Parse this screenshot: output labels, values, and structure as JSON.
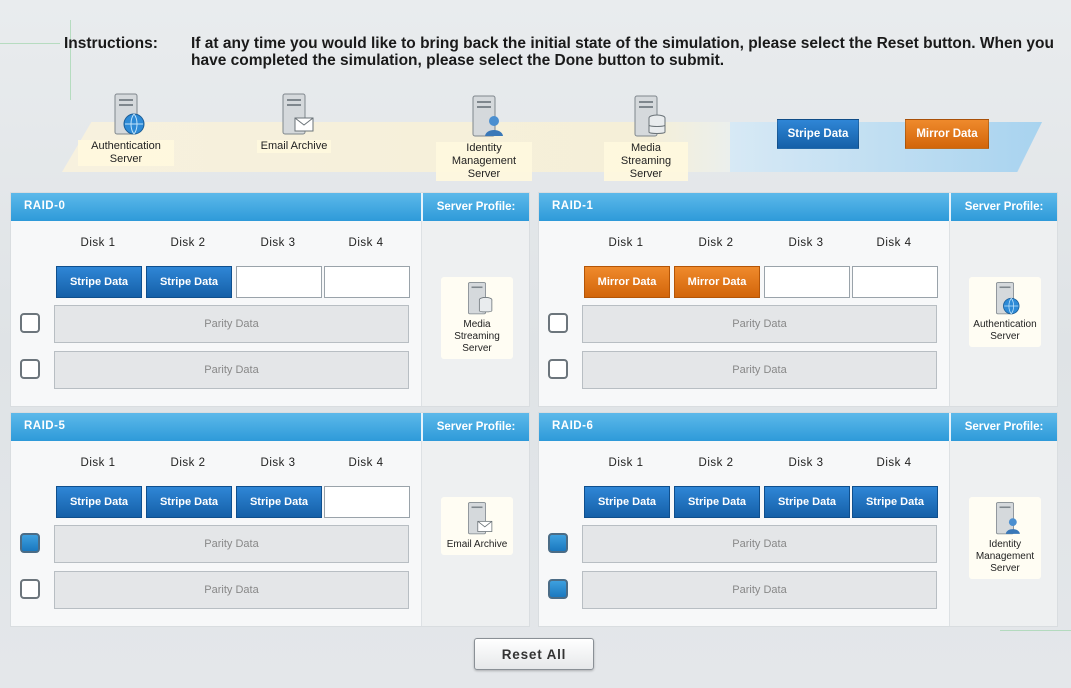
{
  "instructions": {
    "label": "Instructions:",
    "text": "If at any time you would like to bring back the initial state of the simulation, please select the Reset button. When you have completed the simulation, please select the Done button to submit."
  },
  "servers": [
    {
      "name": "Authentication Server",
      "icon": "server-globe-icon"
    },
    {
      "name": "Email Archive",
      "icon": "server-mail-icon"
    },
    {
      "name": "Identity Management Server",
      "icon": "server-user-icon"
    },
    {
      "name": "Media Streaming Server",
      "icon": "server-database-icon"
    }
  ],
  "tags": {
    "stripe": "Stripe Data",
    "mirror": "Mirror Data"
  },
  "colors": {
    "header": "#2e9ad9",
    "stripe": "#1b6fbf",
    "mirror": "#e07a1a"
  },
  "profile_label": "Server Profile:",
  "disk_labels": [
    "Disk 1",
    "Disk 2",
    "Disk 3",
    "Disk 4"
  ],
  "parity_label": "Parity Data",
  "raid": [
    {
      "title": "RAID-0",
      "slots": [
        "Stripe Data",
        "Stripe Data",
        "",
        ""
      ],
      "parity_checked": [
        false,
        false
      ],
      "profile": "Media Streaming Server"
    },
    {
      "title": "RAID-1",
      "slots": [
        "Mirror Data",
        "Mirror Data",
        "",
        ""
      ],
      "parity_checked": [
        false,
        false
      ],
      "profile": "Authentication Server"
    },
    {
      "title": "RAID-5",
      "slots": [
        "Stripe Data",
        "Stripe Data",
        "Stripe Data",
        ""
      ],
      "parity_checked": [
        true,
        false
      ],
      "profile": "Email Archive"
    },
    {
      "title": "RAID-6",
      "slots": [
        "Stripe Data",
        "Stripe Data",
        "Stripe Data",
        "Stripe Data"
      ],
      "parity_checked": [
        true,
        true
      ],
      "profile": "Identity Management Server"
    }
  ],
  "reset_label": "Reset All"
}
